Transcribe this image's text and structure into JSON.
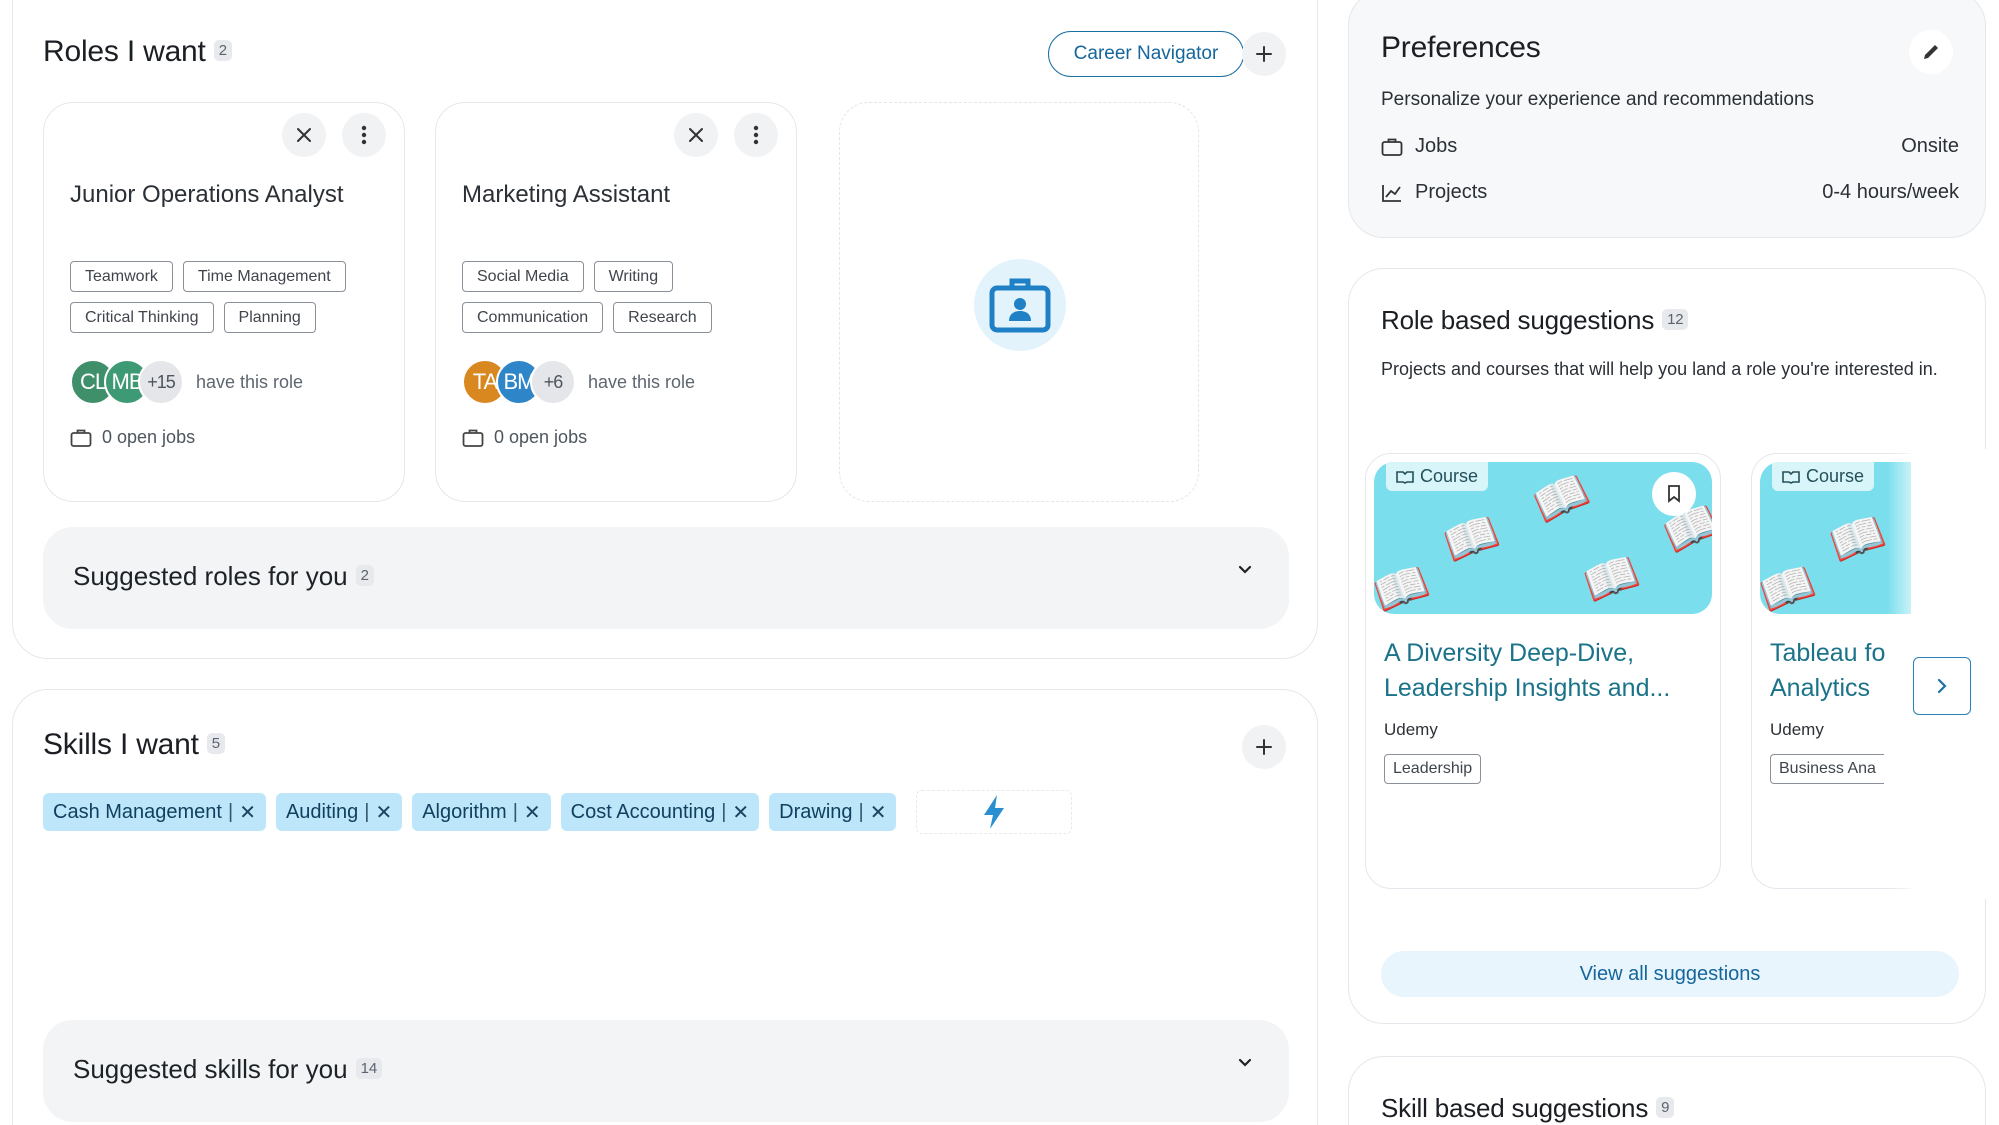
{
  "roles": {
    "title": "Roles I want",
    "count": "2",
    "career_navigator_label": "Career Navigator",
    "cards": [
      {
        "title": "Junior Operations Analyst",
        "tags": [
          "Teamwork",
          "Time Management",
          "Critical Thinking",
          "Planning"
        ],
        "avatars": [
          {
            "initials": "CL",
            "color": "#3f8f6b"
          },
          {
            "initials": "MB",
            "color": "#3e9a74"
          }
        ],
        "more": "+15",
        "have_role": "have this role",
        "open_jobs": "0 open jobs"
      },
      {
        "title": "Marketing Assistant",
        "tags": [
          "Social Media",
          "Writing",
          "Communication",
          "Research"
        ],
        "avatars": [
          {
            "initials": "TA",
            "color": "#d9871f"
          },
          {
            "initials": "BM",
            "color": "#2e86c9"
          }
        ],
        "more": "+6",
        "have_role": "have this role",
        "open_jobs": "0 open jobs"
      }
    ],
    "suggested_label": "Suggested roles for you",
    "suggested_count": "2"
  },
  "skills": {
    "title": "Skills I want",
    "count": "5",
    "chips": [
      "Cash Management",
      "Auditing",
      "Algorithm",
      "Cost Accounting",
      "Drawing"
    ],
    "suggested_label": "Suggested skills for you",
    "suggested_count": "14"
  },
  "preferences": {
    "title": "Preferences",
    "subtitle": "Personalize your experience and recommendations",
    "rows": [
      {
        "label": "Jobs",
        "value": "Onsite"
      },
      {
        "label": "Projects",
        "value": "0-4 hours/week"
      }
    ]
  },
  "role_suggestions": {
    "title": "Role based suggestions",
    "count": "12",
    "description": "Projects and courses that will help you land a role you're interested in.",
    "cards": [
      {
        "type": "Course",
        "title_line1": "A Diversity Deep-Dive,",
        "title_line2": "Leadership Insights and...",
        "provider": "Udemy",
        "tag": "Leadership"
      },
      {
        "type": "Course",
        "title_line1": "Tableau fo",
        "title_line2": "Analytics",
        "provider": "Udemy",
        "tag": "Business Ana"
      }
    ],
    "view_all_label": "View all suggestions"
  },
  "skill_suggestions": {
    "title": "Skill based suggestions",
    "count": "9"
  },
  "colors": {
    "accent": "#15669c",
    "chip_bg": "#bde6fa",
    "course_banner": "#7adeed",
    "lightning": "#2a8fd0"
  }
}
